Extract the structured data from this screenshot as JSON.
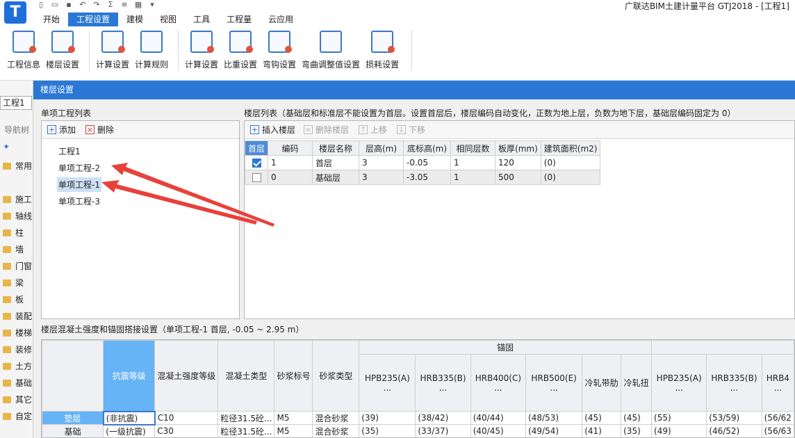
{
  "app": {
    "title": "广联达BIM土建计量平台 GTJ2018 - [工程1]",
    "logo_letter": "T"
  },
  "menu_tabs": [
    "开始",
    "工程设置",
    "建模",
    "视图",
    "工具",
    "工程量",
    "云应用"
  ],
  "ribbon": {
    "group1": [
      "工程信息",
      "楼层设置"
    ],
    "group2": [
      "计算设置",
      "计算规则"
    ],
    "group3": [
      "计算设置",
      "比重设置",
      "弯钩设置",
      "弯曲调整值设置",
      "损耗设置"
    ]
  },
  "sidebar": {
    "project_field": "工程1",
    "nav_header": "导航树",
    "items": [
      "常用",
      "施工",
      "轴线",
      "柱",
      "墙",
      "门窗",
      "梁",
      "板",
      "装配",
      "楼梯",
      "装修",
      "土方",
      "基础",
      "其它",
      "自定"
    ]
  },
  "dialog": {
    "title": "楼层设置",
    "project_list_label": "单项工程列表",
    "add_label": "添加",
    "delete_label": "删除",
    "projects": [
      "工程1",
      "单项工程-2",
      "单项工程-1",
      "单项工程-3"
    ],
    "floor_list_label": "楼层列表（基础层和标准层不能设置为首层。设置首层后，楼层编码自动变化，正数为地上层，负数为地下层，基础层编码固定为 0）",
    "floor_toolbar": [
      "插入楼层",
      "删除楼层",
      "上移",
      "下移"
    ],
    "floor_headers": [
      "首层",
      "编码",
      "楼层名称",
      "层高(m)",
      "底标高(m)",
      "相同层数",
      "板厚(mm)",
      "建筑面积(m2)"
    ],
    "floors": [
      {
        "first": true,
        "code": "1",
        "name": "首层",
        "height": "3",
        "bottom": "-0.05",
        "same": "1",
        "thick": "120",
        "area": "(0)"
      },
      {
        "first": false,
        "code": "0",
        "name": "基础层",
        "height": "3",
        "bottom": "-3.05",
        "same": "1",
        "thick": "500",
        "area": "(0)"
      }
    ],
    "concrete_label": "楼层混凝土强度和锚固搭接设置（单项工程-1  首层, -0.05 ~ 2.95 m）",
    "concrete_headers": {
      "seismic": "抗震等级",
      "strength": "混凝土强度等级",
      "type": "混凝土类型",
      "mortar_no": "砂浆标号",
      "mortar_type": "砂浆类型",
      "anchor_group": "锚固",
      "anchor_cols": [
        "HPB235(A)",
        "HRB335(B)",
        "HRB400(C)",
        "HRB500(E)",
        "冷轧带肋",
        "冷轧扭"
      ],
      "lap_cols": [
        "HPB235(A)",
        "HRB335(B)",
        "HRB4"
      ],
      "ellipsis": "..."
    },
    "concrete_rows": [
      {
        "name": "垫层",
        "seismic": "(非抗震)",
        "strength": "C10",
        "type": "粒径31.5砼...",
        "mortar_no": "M5",
        "mortar_type": "混合砂浆",
        "anchor": [
          "(39)",
          "(38/42)",
          "(40/44)",
          "(48/53)",
          "(45)",
          "(45)"
        ],
        "lap": [
          "(55)",
          "(53/59)",
          "(56/62"
        ]
      },
      {
        "name": "基础",
        "seismic": "(一级抗震)",
        "strength": "C30",
        "type": "粒径31.5砼...",
        "mortar_no": "M5",
        "mortar_type": "混合砂浆",
        "anchor": [
          "(35)",
          "(33/37)",
          "(40/45)",
          "(49/54)",
          "(41)",
          "(35)"
        ],
        "lap": [
          "(49)",
          "(46/52)",
          "(56/63"
        ]
      }
    ]
  },
  "colors": {
    "accent": "#2b78d4",
    "highlight_cell": "#66b3f5",
    "annotation_arrow": "#e8413a"
  }
}
